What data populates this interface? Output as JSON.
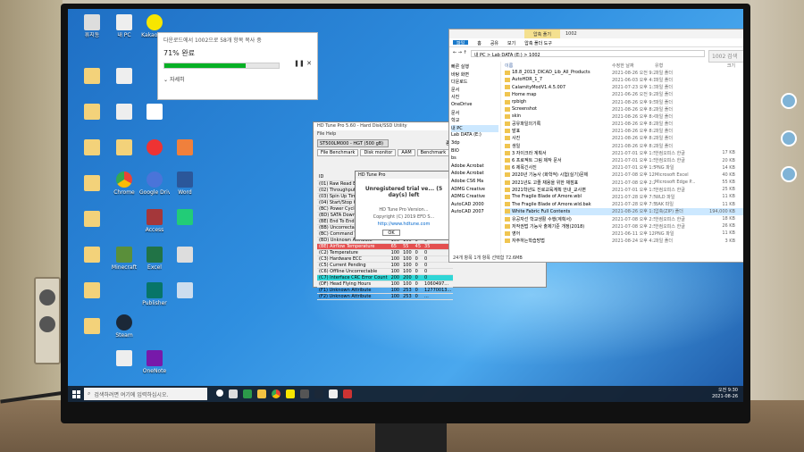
{
  "desktop_icons": [
    {
      "label": "휴지통"
    },
    {
      "label": "내 PC"
    },
    {
      "label": "KakaoTalk"
    },
    {
      "label": "Chrome"
    },
    {
      "label": "Google Drive"
    },
    {
      "label": "Word"
    },
    {
      "label": "Steam"
    },
    {
      "label": "Minecraft"
    },
    {
      "label": "Excel"
    },
    {
      "label": "OneNote"
    },
    {
      "label": "Access"
    },
    {
      "label": "Publisher"
    }
  ],
  "copy_dialog": {
    "title": "다운로드에서 1002으로 58개 항목 복사 중",
    "percent_label": "71% 완료",
    "progress": 0.71,
    "details": "자세히"
  },
  "hdtune": {
    "title": "HD Tune Pro 5.60 - Hard Disk/SSD Utility",
    "menu": "File  Help",
    "drive": "ST500LM000 - HGT (500 gB)",
    "exit_label": "종료",
    "tabs": [
      "File Benchmark",
      "Disk monitor",
      "AAM",
      "Benchmark",
      "Info",
      "Health",
      "Error Scan"
    ],
    "smart_rows": [
      {
        "id": "ID",
        "cur": "",
        "wst": "",
        "thr": "",
        "data": ""
      },
      {
        "id": "(01) Raw Read Error Rate",
        "cur": "100",
        "wst": "100",
        "thr": "62",
        "data": "0"
      },
      {
        "id": "(02) Throughput Perf.",
        "cur": "100",
        "wst": "100",
        "thr": "40",
        "data": "0"
      },
      {
        "id": "(03) Spin Up Time",
        "cur": "100",
        "wst": "100",
        "thr": "33",
        "data": "0"
      },
      {
        "id": "(04) Start/Stop Count",
        "cur": "100",
        "wst": "100",
        "thr": "0",
        "data": "0"
      },
      {
        "id": "(BC) Power Cycle Count",
        "cur": "100",
        "wst": "100",
        "thr": "0",
        "data": "0"
      },
      {
        "id": "(BD) SATA Downshift",
        "cur": "100",
        "wst": "100",
        "thr": "0",
        "data": "0"
      },
      {
        "id": "(BE) End To End Error",
        "cur": "100",
        "wst": "100",
        "thr": "0",
        "data": "0"
      },
      {
        "id": "(BB) Uncorrectable",
        "cur": "100",
        "wst": "100",
        "thr": "0",
        "data": "0"
      },
      {
        "id": "(BC) Command Timeout",
        "cur": "100",
        "wst": "100",
        "thr": "0",
        "data": "0"
      },
      {
        "id": "(BD) Unknown Attribute",
        "cur": "100",
        "wst": "100",
        "thr": "0",
        "data": "0"
      },
      {
        "id": "(BE) Airflow Temperature",
        "cur": "65",
        "wst": "55",
        "thr": "45",
        "data": "35"
      },
      {
        "id": "(C2) Temperature",
        "cur": "100",
        "wst": "100",
        "thr": "0",
        "data": "0"
      },
      {
        "id": "(C3) Hardware ECC",
        "cur": "100",
        "wst": "100",
        "thr": "0",
        "data": "0"
      },
      {
        "id": "(C5) Current Pending",
        "cur": "100",
        "wst": "100",
        "thr": "0",
        "data": "0"
      },
      {
        "id": "(C6) Offline Uncorrectable",
        "cur": "100",
        "wst": "100",
        "thr": "0",
        "data": "0"
      },
      {
        "id": "(C7) Interface CRC Error Count",
        "cur": "200",
        "wst": "200",
        "thr": "0",
        "data": "0"
      },
      {
        "id": "(DF) Head Flying Hours",
        "cur": "100",
        "wst": "100",
        "thr": "0",
        "data": "1060497..."
      },
      {
        "id": "(F1) Unknown Attribute",
        "cur": "100",
        "wst": "253",
        "thr": "0",
        "data": "12770013..."
      },
      {
        "id": "(F2) Unknown Attribute",
        "cur": "100",
        "wst": "253",
        "thr": "0",
        "data": "..."
      }
    ],
    "popup": {
      "title": "HD Tune Pro",
      "message": "Unregistered trial ve... (5 day(s) left",
      "version": "HD Tune Pro Version...",
      "copyright": "Copyright (C) 2019 EFD S...",
      "link": "http://www.hdtune.com",
      "ok": "OK"
    }
  },
  "explorer": {
    "title": "1002",
    "manage_tab": "압축 풀기",
    "ribbon": [
      "파일",
      "홈",
      "공유",
      "보기",
      "압축 폴더 도구"
    ],
    "path": "내 PC > Lab DATA (E:) > 1002",
    "search_placeholder": "1002 검색",
    "nav": [
      "빠른 실행",
      "바탕 화면",
      "다운로드",
      "문서",
      "사진",
      "OneDrive",
      "문서",
      "학교",
      "내 PC",
      "Lab DATA (E:)",
      "3dp",
      "BIO",
      "bs",
      "Adobe Acrobat",
      "Adobe Acrobat",
      "Adobe CS6 Ma",
      "ADMG Creative",
      "ADMG Creative",
      "AutoCAD 2000",
      "AutoCAD 2007"
    ],
    "columns": [
      "이름",
      "수정한 날짜",
      "유형",
      "크기"
    ],
    "rows": [
      {
        "name": "18.8_2013_DICAD_Lib_All_Products",
        "date": "2021-08-26 오전 9:20",
        "type": "파일 폴더",
        "size": ""
      },
      {
        "name": "AutoHDR_1_7",
        "date": "2021-06-03 오후 4:16",
        "type": "파일 폴더",
        "size": ""
      },
      {
        "name": "CalamityModV1.4.5.007",
        "date": "2021-07-23 오후 1:31",
        "type": "파일 폴더",
        "size": ""
      },
      {
        "name": "Home map",
        "date": "2021-06-26 오전 9:23",
        "type": "파일 폴더",
        "size": ""
      },
      {
        "name": "rpbigh",
        "date": "2021-08-26 오후 9:53",
        "type": "파일 폴더",
        "size": ""
      },
      {
        "name": "Screenshot",
        "date": "2021-08-26 오후 8:29",
        "type": "파일 폴더",
        "size": ""
      },
      {
        "name": "skin",
        "date": "2021-08-26 오후 8:43",
        "type": "파일 폴더",
        "size": ""
      },
      {
        "name": "공유파일의기록",
        "date": "2021-08-26 오후 8:26",
        "type": "파일 폴더",
        "size": ""
      },
      {
        "name": "발표",
        "date": "2021-08-26 오후 8:27",
        "type": "파일 폴더",
        "size": ""
      },
      {
        "name": "사진",
        "date": "2021-08-26 오후 8:21",
        "type": "파일 폴더",
        "size": ""
      },
      {
        "name": "생일",
        "date": "2021-08-26 오후 8:28",
        "type": "파일 폴더",
        "size": ""
      },
      {
        "name": "3 자이크라 계획서",
        "date": "2021-07-01 오후 1:57",
        "type": "한컴오피스 한글",
        "size": "17 KB"
      },
      {
        "name": "6 프로젝트 그림 제작 문서",
        "date": "2021-07-01 오후 1:57",
        "type": "한컴오피스 한글",
        "size": "20 KB"
      },
      {
        "name": "6 제목긴사진",
        "date": "2021-07-01 오후 1:57",
        "type": "PNG 파일",
        "size": "14 KB"
      },
      {
        "name": "2020년 기능사 (화학적) 시험(실기)문제",
        "date": "2021-07-08 오후 12:48",
        "type": "Microsoft Excel",
        "size": "40 KB"
      },
      {
        "name": "2021년도 고졸 채용을 위한 채점표",
        "date": "2021-07-08 오후 2:22",
        "type": "Microsoft Edge P...",
        "size": "55 KB"
      },
      {
        "name": "2021학년도 진로교육계획 안내_교사편",
        "date": "2021-07-01 오후 1:57",
        "type": "한컴오피스 한글",
        "size": "25 KB"
      },
      {
        "name": "The Fragile Blade of Amore.wbl",
        "date": "2021-07-28 오후 7:57",
        "type": "WLD 파일",
        "size": "11 KB"
      },
      {
        "name": "The Fragile Blade of Amore.wld.bak",
        "date": "2021-07-28 오후 7:57",
        "type": "BAK 파일",
        "size": "11 KB"
      },
      {
        "name": "White Fabric Full Contents",
        "date": "2021-08-26 오후 1:10",
        "type": "압축(ZIP) 폴더",
        "size": "194,000 KB"
      },
      {
        "name": "유공자선 학교생활 수행(계획서)",
        "date": "2021-07-08 오후 2:55",
        "type": "한컴오피스 한글",
        "size": "18 KB"
      },
      {
        "name": "저작권법 기능사 출제기준 개정(2018)",
        "date": "2021-07-08 오후 2:51",
        "type": "한컴오피스 한글",
        "size": "26 KB"
      },
      {
        "name": "영어",
        "date": "2021-06-11 오후 12:28",
        "type": "PNG 파일",
        "size": "11 KB"
      },
      {
        "name": "자주하는학습방법",
        "date": "2021-08-24 오후 4:27",
        "type": "파일 폴더",
        "size": "3 KB"
      }
    ],
    "selected_row": 19,
    "status": "24개 항목   1개 항목 선택함 72.6MB"
  },
  "taskbar": {
    "search_placeholder": "검색하려면 여기에 입력하십시오.",
    "time": "오전 9:30",
    "date": "2021-08-26"
  }
}
